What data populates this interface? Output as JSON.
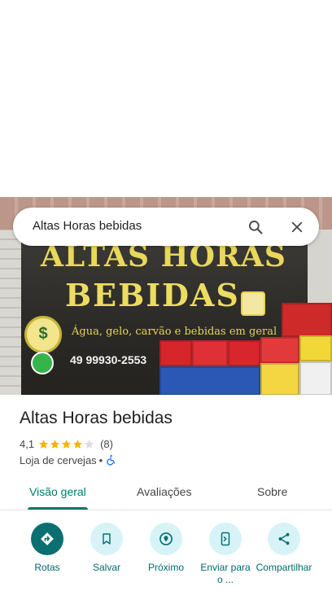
{
  "search": {
    "query": "Altas Horas bebidas"
  },
  "photo": {
    "sign_line1": "ALTAS HORAS",
    "sign_line2": "BEBIDAS",
    "sign_subtitle": "Água, gelo, carvão e bebidas em geral",
    "sign_phone": "49 99930-2553"
  },
  "place": {
    "name": "Altas Horas bebidas",
    "rating": "4,1",
    "rating_value": 4.1,
    "review_count": "(8)",
    "category": "Loja de cervejas",
    "separator": "•",
    "accessibility_icon": "wheelchair-icon"
  },
  "tabs": [
    {
      "label": "Visão geral",
      "selected": true
    },
    {
      "label": "Avaliações",
      "selected": false
    },
    {
      "label": "Sobre",
      "selected": false
    }
  ],
  "actions": [
    {
      "label": "Rotas",
      "icon": "directions-icon"
    },
    {
      "label": "Salvar",
      "icon": "bookmark-icon"
    },
    {
      "label": "Próximo",
      "icon": "nearby-icon"
    },
    {
      "label": "Enviar para o ...",
      "icon": "send-to-phone-icon"
    },
    {
      "label": "Compartilhar",
      "icon": "share-icon"
    }
  ],
  "colors": {
    "accent": "#00796b",
    "primary_action": "#0b6f71",
    "action_bg": "#d7f3f7",
    "star": "#f6b400"
  }
}
